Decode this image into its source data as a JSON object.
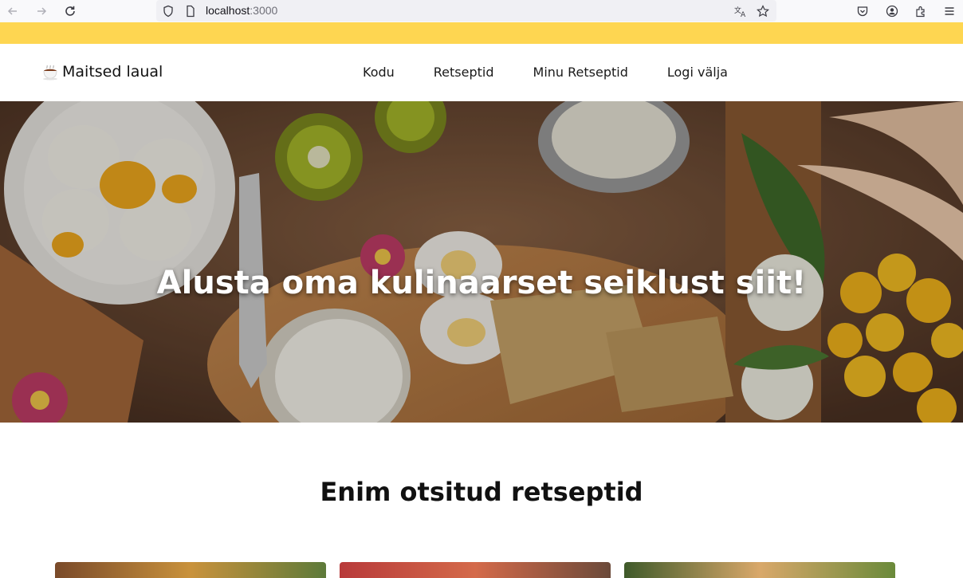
{
  "browser": {
    "url_host": "localhost",
    "url_port": ":3000",
    "icons": [
      "back-icon",
      "forward-icon",
      "reload-icon",
      "shield-icon",
      "page-icon",
      "translate-icon",
      "bookmark-star-icon",
      "pocket-icon",
      "account-icon",
      "extensions-icon",
      "menu-icon"
    ]
  },
  "site": {
    "logo_text": "Maitsed laual",
    "logo_icon": "coffee-cup-icon",
    "nav": [
      {
        "label": "Kodu"
      },
      {
        "label": "Retseptid"
      },
      {
        "label": "Minu Retseptid"
      },
      {
        "label": "Logi välja"
      }
    ]
  },
  "hero": {
    "title": "Alusta oma kulinaarset seiklust siit!"
  },
  "section": {
    "title": "Enim otsitud retseptid"
  },
  "colors": {
    "accent_strip": "#fed651",
    "hero_text": "#ffffff"
  }
}
